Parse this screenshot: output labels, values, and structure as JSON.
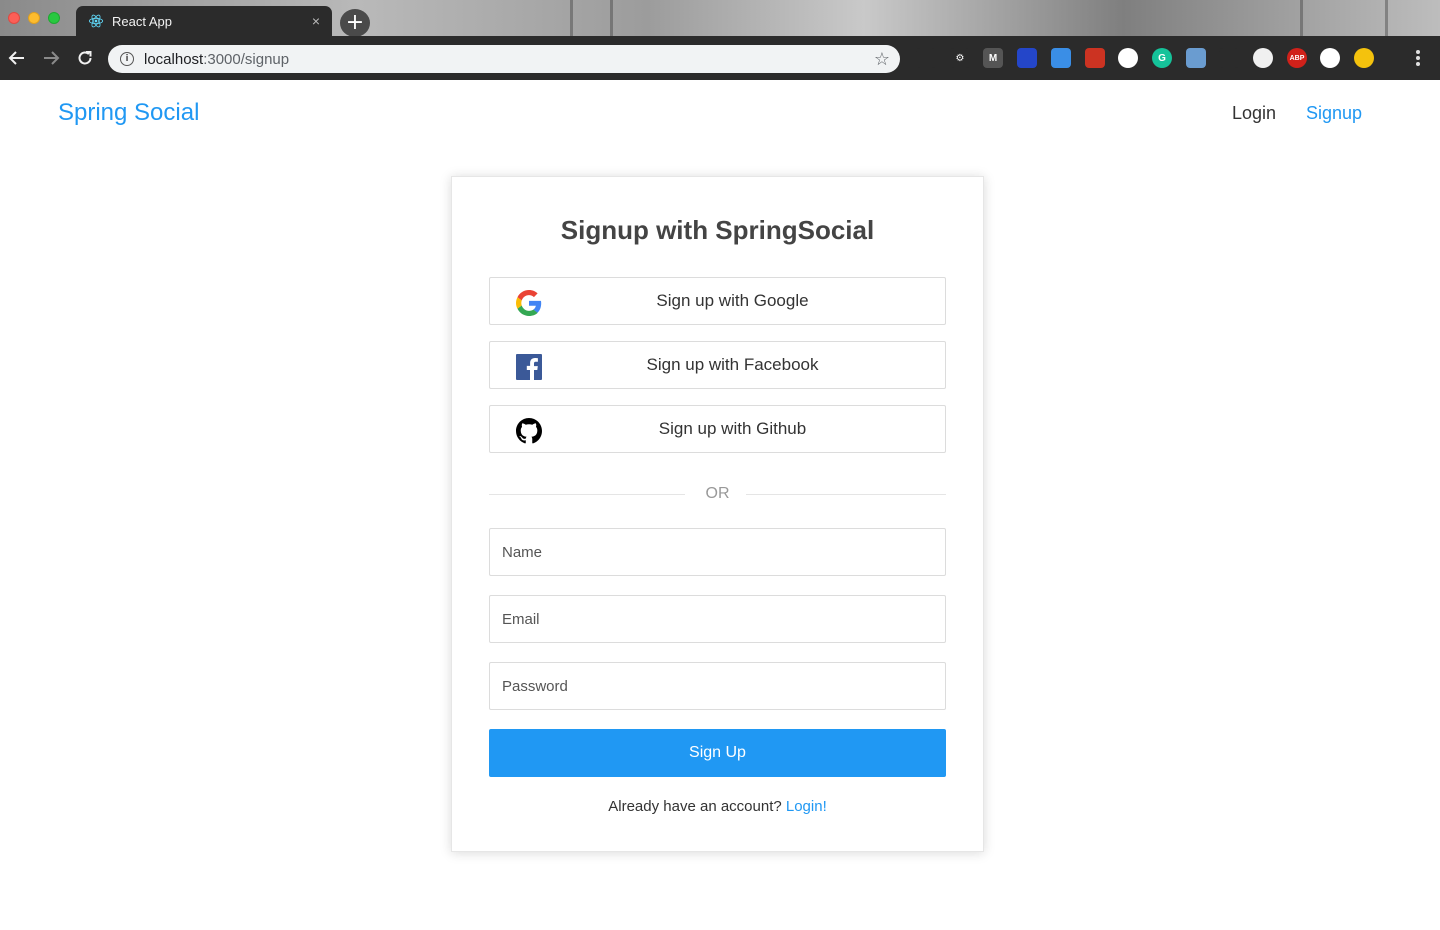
{
  "browser": {
    "tab_title": "React App",
    "tab_close": "×",
    "new_tab": "+",
    "url_host": "localhost",
    "url_path": ":3000/signup",
    "bookmark_star": "☆",
    "extensions": [
      {
        "icon": "sync-icon",
        "label": "",
        "color": "#2b2b2b"
      },
      {
        "icon": "gear-extension-icon",
        "label": "⚙",
        "color": "#2b2b2b"
      },
      {
        "icon": "gmail-m-icon",
        "label": "M",
        "color": "#555555"
      },
      {
        "icon": "bookmark-blue-icon",
        "label": "",
        "color": "#2446c9"
      },
      {
        "icon": "translate-icon",
        "label": "",
        "color": "#3a8ee6"
      },
      {
        "icon": "red-puzzle-icon",
        "label": "",
        "color": "#cc3322"
      },
      {
        "icon": "shield-white-icon",
        "label": "",
        "color": "#ffffff"
      },
      {
        "icon": "grammarly-icon",
        "label": "G",
        "color": "#15c39a"
      },
      {
        "icon": "screenshot-icon",
        "label": "",
        "color": "#6a9cd0"
      },
      {
        "icon": "lightbulb-icon",
        "label": "",
        "color": "#2b2b2b"
      },
      {
        "icon": "white-circle-icon",
        "label": "",
        "color": "#f0f0f0"
      },
      {
        "icon": "adblock-icon",
        "label": "ABP",
        "color": "#d0211a"
      },
      {
        "icon": "qr-code-icon",
        "label": "",
        "color": "#ffffff"
      },
      {
        "icon": "profile-avatar-icon",
        "label": "",
        "color": "#f4c20d"
      }
    ]
  },
  "header": {
    "brand": "Spring Social",
    "nav_login": "Login",
    "nav_signup": "Signup"
  },
  "signup": {
    "title": "Signup with SpringSocial",
    "google_label": "Sign up with Google",
    "facebook_label": "Sign up with Facebook",
    "github_label": "Sign up with Github",
    "or_text": "OR",
    "name_placeholder": "Name",
    "email_placeholder": "Email",
    "password_placeholder": "Password",
    "submit_label": "Sign Up",
    "login_prompt": "Already have an account? ",
    "login_link": "Login!"
  },
  "colors": {
    "accent": "#2098f3",
    "facebook": "#3b5998",
    "github": "#000000"
  }
}
